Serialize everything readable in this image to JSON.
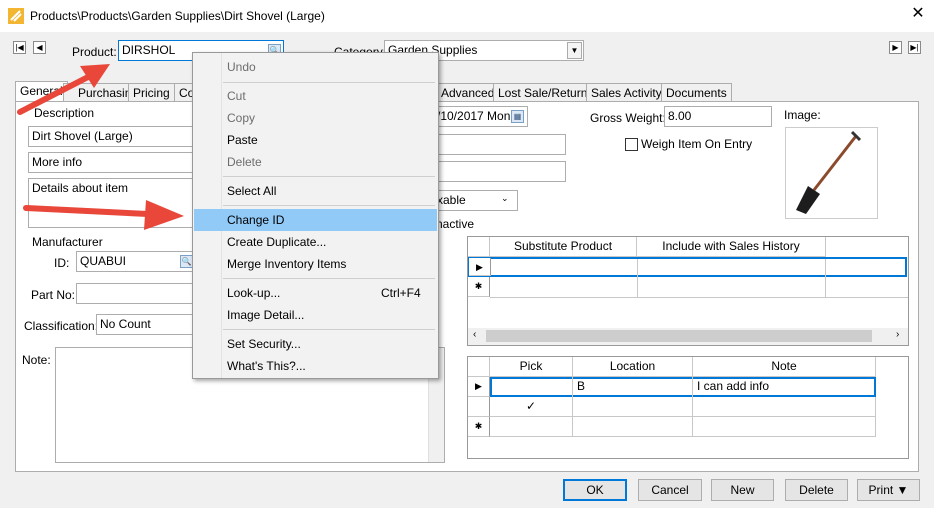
{
  "window": {
    "title": "Products\\Products\\Garden Supplies\\Dirt Shovel (Large)",
    "close": "✕"
  },
  "nav": {
    "first": "|◀",
    "prev": "◀",
    "next": "▶",
    "last": "▶|"
  },
  "product": {
    "label": "Product:",
    "value": "DIRSHOL",
    "lookup": "🔍"
  },
  "category": {
    "label": "Category:",
    "value": "Garden Supplies"
  },
  "tabs": [
    "General",
    "Purchasing",
    "Pricing",
    "Co",
    "Advanced",
    "Lost Sale/Return",
    "Sales Activity",
    "Documents"
  ],
  "general": {
    "description_label": "Description",
    "desc_line1": "Dirt Shovel (Large)",
    "desc_line2": "More info",
    "desc_details": "Details about item",
    "manufacturer_label": "Manufacturer",
    "id_label": "ID:",
    "id_value": "QUABUI",
    "partno_label": "Part No:",
    "partno_value": "",
    "classification_label": "Classification:",
    "classification_value": "No Count",
    "note_label": "Note:"
  },
  "right": {
    "date_value": "/10/2017 Mon",
    "gross_weight_label": "Gross Weight:",
    "gross_weight_value": "8.00",
    "weigh_label": "Weigh Item On Entry",
    "image_label": "Image:",
    "taxable_value": "xable",
    "inactive_label": "nactive"
  },
  "substitute_grid": {
    "headers": [
      "Substitute Product",
      "Include with Sales History"
    ],
    "row_markers": [
      "▶",
      "✱"
    ]
  },
  "location_grid": {
    "headers": [
      "Pick",
      "Location",
      "Note"
    ],
    "rows": [
      {
        "marker": "▶",
        "pick": "",
        "location": "B",
        "note": "I can add info"
      },
      {
        "marker": "",
        "pick": "✓",
        "location": "",
        "note": ""
      },
      {
        "marker": "✱",
        "pick": "",
        "location": "",
        "note": ""
      }
    ]
  },
  "context_menu": {
    "undo": "Undo",
    "cut": "Cut",
    "copy": "Copy",
    "paste": "Paste",
    "delete": "Delete",
    "select_all": "Select All",
    "change_id": "Change ID",
    "create_duplicate": "Create Duplicate...",
    "merge_inventory": "Merge Inventory Items",
    "lookup": "Look-up...",
    "lookup_shortcut": "Ctrl+F4",
    "image_detail": "Image Detail...",
    "set_security": "Set Security...",
    "whats_this": "What's This?..."
  },
  "buttons": {
    "ok": "OK",
    "cancel": "Cancel",
    "new": "New",
    "delete": "Delete",
    "print": "Print ▼"
  },
  "colors": {
    "arrow": "#e8473a",
    "highlight": "#91c9f7",
    "focus": "#0078d7"
  }
}
